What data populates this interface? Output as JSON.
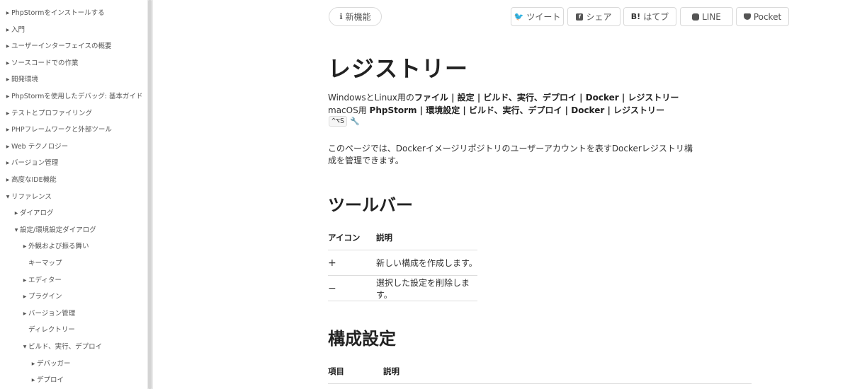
{
  "sidebar": {
    "items": [
      {
        "label": "PhpStormをインストールする",
        "caret": "right",
        "level": 0
      },
      {
        "label": "入門",
        "caret": "right",
        "level": 0
      },
      {
        "label": "ユーザーインターフェイスの概要",
        "caret": "right",
        "level": 0
      },
      {
        "label": "ソースコードでの作業",
        "caret": "right",
        "level": 0
      },
      {
        "label": "開発環境",
        "caret": "right",
        "level": 0
      },
      {
        "label": "PhpStormを使用したデバッグ: 基本ガイド",
        "caret": "right",
        "level": 0
      },
      {
        "label": "テストとプロファイリング",
        "caret": "right",
        "level": 0
      },
      {
        "label": "PHPフレームワークと外部ツール",
        "caret": "right",
        "level": 0
      },
      {
        "label": "Web テクノロジー",
        "caret": "right",
        "level": 0
      },
      {
        "label": "バージョン管理",
        "caret": "right",
        "level": 0
      },
      {
        "label": "高度なIDE機能",
        "caret": "right",
        "level": 0
      },
      {
        "label": "リファレンス",
        "caret": "down",
        "level": 0
      },
      {
        "label": "ダイアログ",
        "caret": "right",
        "level": 1
      },
      {
        "label": "設定/環境設定ダイアログ",
        "caret": "down",
        "level": 1
      },
      {
        "label": "外観および振る舞い",
        "caret": "right",
        "level": 2
      },
      {
        "label": "キーマップ",
        "caret": "none",
        "level": 2
      },
      {
        "label": "エディター",
        "caret": "right",
        "level": 2
      },
      {
        "label": "プラグイン",
        "caret": "right",
        "level": 2
      },
      {
        "label": "バージョン管理",
        "caret": "right",
        "level": 2
      },
      {
        "label": "ディレクトリー",
        "caret": "none",
        "level": 2
      },
      {
        "label": "ビルド、実行、デプロイ",
        "caret": "down",
        "level": 2
      },
      {
        "label": "デバッガー",
        "caret": "right",
        "level": 3
      },
      {
        "label": "デプロイ",
        "caret": "right",
        "level": 3
      }
    ]
  },
  "header": {
    "new_features": "新機能",
    "share": [
      {
        "label": "ツイート",
        "icon": "twitter-bird-icon"
      },
      {
        "label": "シェア",
        "icon": "facebook-f-icon"
      },
      {
        "label": "はてブ",
        "icon": "hatena-b-icon",
        "prefix": "B!"
      },
      {
        "label": "LINE",
        "icon": "line-icon"
      },
      {
        "label": "Pocket",
        "icon": "pocket-icon"
      }
    ]
  },
  "article": {
    "title": "レジストリー",
    "win_prefix": "WindowsとLinux用の",
    "win_path": "ファイル | 設定 | ビルド、実行、デプロイ | Docker | レジストリー",
    "mac_prefix": "macOS用 ",
    "mac_path": "PhpStorm | 環境設定 | ビルド、実行、デプロイ | Docker | レジストリー",
    "shortcut": "^⌥S",
    "description": "このページでは、Dockerイメージリポジトリのユーザーアカウントを表すDockerレジストリ構成を管理できます。",
    "toolbar_heading": "ツールバー",
    "toolbar_table": {
      "headers": [
        "アイコン",
        "説明"
      ],
      "rows": [
        {
          "icon": "+",
          "desc": "新しい構成を作成します。"
        },
        {
          "icon": "−",
          "desc": "選択した設定を削除します。"
        }
      ]
    },
    "config_heading": "構成設定",
    "config_table": {
      "headers": [
        "項目",
        "説明"
      ]
    }
  }
}
